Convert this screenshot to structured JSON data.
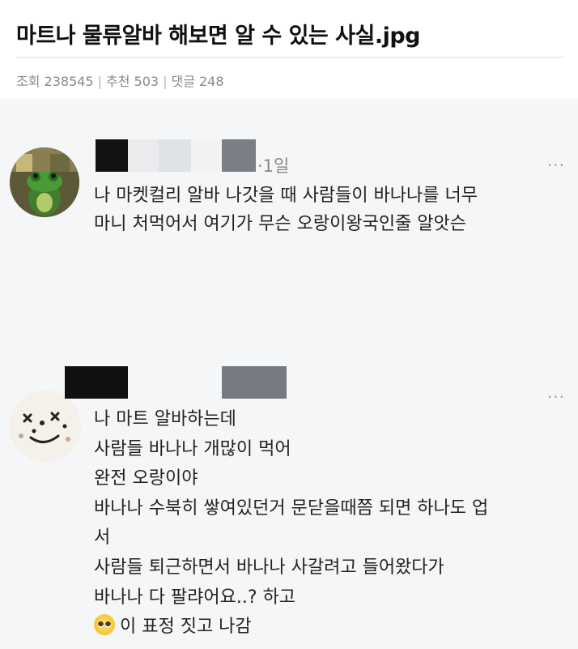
{
  "post": {
    "title": "마트나 물류알바 해보면 알 수 있는 사실.jpg",
    "views": "조회 238545",
    "recommends": "추천 503",
    "comments": "댓글 248",
    "separator": "|"
  },
  "screenshot": {
    "comments": [
      {
        "time": "·1일",
        "more": "···",
        "lines": [
          "나 마켓컬리 알바 나갓을 때 사람들이 바나나를 너무",
          "마니 처먹어서 여기가 무슨 오랑이왕국인줄 알앗슨"
        ]
      },
      {
        "more": "···",
        "lines": [
          "나 마트 알바하는데",
          "사람들 바나나 개많이 먹어",
          "완전 오랑이야",
          "바나나 수북히 쌓여있던거 문닫을때쯤 되면 하나도 업",
          "서",
          "사람들 퇴근하면서 바나나 사갈려고 들어왔다가",
          "바나나 다 팔랴어요..? 하고",
          "이 표정 짓고 나감"
        ],
        "emoji": "pleading-face-icon"
      }
    ]
  },
  "colors": {
    "screenshot_background": "#f5f6f8",
    "meta_text": "#8a8a8a"
  }
}
